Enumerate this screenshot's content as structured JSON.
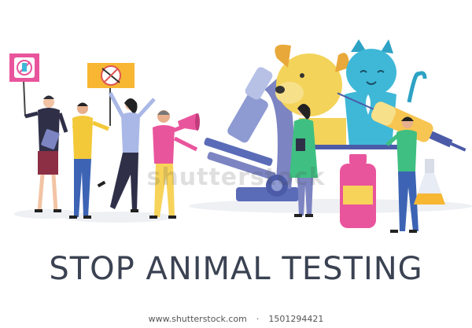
{
  "headline": "STOP ANIMAL TESTING",
  "watermark": "shutterstock",
  "footer": {
    "site": "www.shutterstock.com",
    "separator": "·",
    "image_id": "1501294421"
  },
  "colors": {
    "pink": "#e9559c",
    "orange": "#f7b733",
    "blue_gray": "#7c84c2",
    "yellow_dog": "#f3d35a",
    "cyan_cat": "#3fb8d8",
    "green_coat": "#3fbf82"
  }
}
